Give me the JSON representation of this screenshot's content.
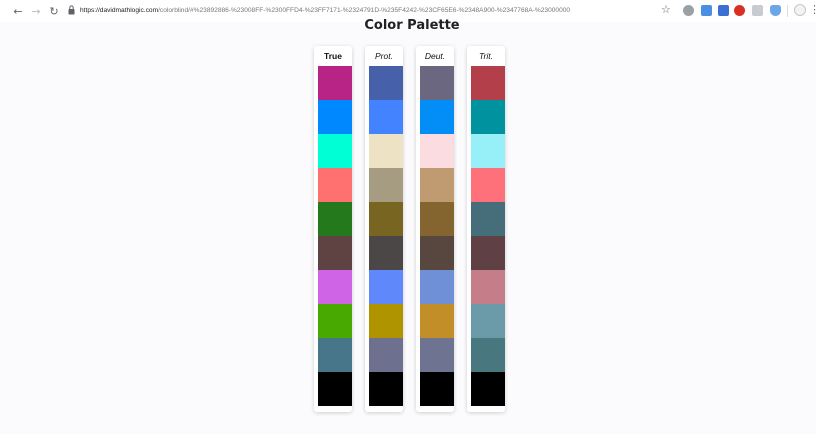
{
  "browser": {
    "url_host": "https://davidmathlogic.com",
    "url_path": "/colorblind/#%23892886-%23008FF-%2300FFD4-%23FF7171-%2324791D-%235F4242-%23CF65E6-%2348A900-%2347768A-%23000000",
    "icons": [
      "back-arrow-icon",
      "forward-arrow-icon",
      "reload-icon",
      "lock-icon",
      "star-icon",
      "menu-dots-icon"
    ]
  },
  "page": {
    "title": "Color Palette"
  },
  "columns": [
    {
      "key": "true",
      "label": "True",
      "style": "bold",
      "swatches": [
        "#B82485",
        "#0088FF",
        "#00FFD4",
        "#FF7171",
        "#24791D",
        "#5F4242",
        "#CF65E6",
        "#48A900",
        "#47768A",
        "#000000"
      ]
    },
    {
      "key": "prot",
      "label": "Prot.",
      "style": "italic",
      "swatches": [
        "#4760AA",
        "#4383FF",
        "#EDE2C4",
        "#A69C82",
        "#776521",
        "#4A4746",
        "#5F88FA",
        "#AF9400",
        "#6E7090",
        "#000000"
      ]
    },
    {
      "key": "deut",
      "label": "Deut.",
      "style": "italic",
      "swatches": [
        "#6B6780",
        "#038EF7",
        "#FBDCE0",
        "#C09A70",
        "#84652F",
        "#57473F",
        "#6F8FD6",
        "#C18E28",
        "#6D7390",
        "#000000"
      ]
    },
    {
      "key": "trit",
      "label": "Trit.",
      "style": "italic",
      "swatches": [
        "#B23F4A",
        "#00939F",
        "#97F0F8",
        "#FF717A",
        "#456E7A",
        "#5F4145",
        "#C57E89",
        "#6B9BA8",
        "#497780",
        "#000000"
      ]
    }
  ]
}
